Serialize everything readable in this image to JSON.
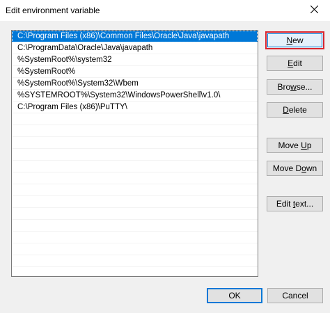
{
  "window": {
    "title": "Edit environment variable",
    "close_icon": "close-icon"
  },
  "paths": [
    "C:\\Program Files (x86)\\Common Files\\Oracle\\Java\\javapath",
    "C:\\ProgramData\\Oracle\\Java\\javapath",
    "%SystemRoot%\\system32",
    "%SystemRoot%",
    "%SystemRoot%\\System32\\Wbem",
    "%SYSTEMROOT%\\System32\\WindowsPowerShell\\v1.0\\",
    "C:\\Program Files (x86)\\PuTTY\\"
  ],
  "selected_index": 0,
  "buttons": {
    "new": {
      "mnemonic": "N",
      "rest": "ew"
    },
    "edit": {
      "mnemonic": "E",
      "rest": "dit"
    },
    "browse": {
      "pre": "Bro",
      "mnemonic": "w",
      "post": "se..."
    },
    "delete": {
      "mnemonic": "D",
      "rest": "elete"
    },
    "move_up": {
      "pre": "Move ",
      "mnemonic": "U",
      "post": "p"
    },
    "move_down": {
      "pre": "Move D",
      "mnemonic": "o",
      "post": "wn"
    },
    "edit_text": {
      "pre": "Edit ",
      "mnemonic": "t",
      "post": "ext..."
    },
    "ok": "OK",
    "cancel": "Cancel"
  },
  "colors": {
    "selection": "#0078d7",
    "highlight_border": "#d9262f",
    "background": "#f0f0f0"
  }
}
